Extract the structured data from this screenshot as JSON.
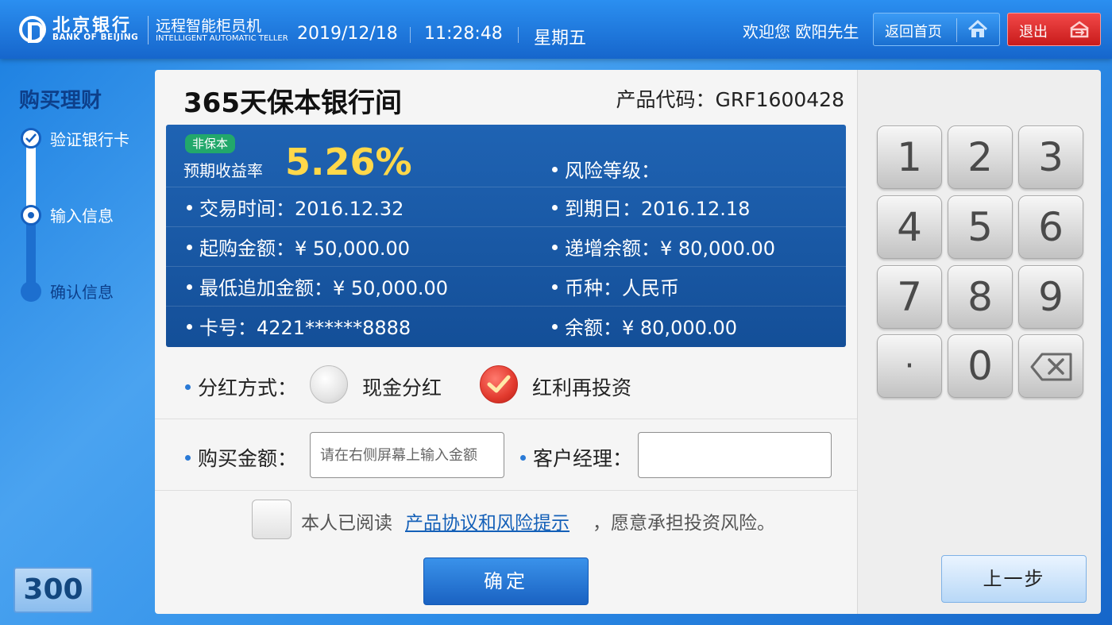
{
  "header": {
    "bank_cn": "北京银行",
    "bank_en": "BANK OF BEIJING",
    "system_cn": "远程智能柜员机",
    "system_en": "INTELLIGENT AUTOMATIC TELLER",
    "date": "2019/12/18",
    "time": "11:28:48",
    "weekday": "星期五",
    "welcome": "欢迎您 欧阳先生",
    "home_label": "返回首页",
    "exit_label": "退出"
  },
  "steps": {
    "title": "购买理财",
    "items": [
      {
        "label": "验证银行卡",
        "state": "done"
      },
      {
        "label": "输入信息",
        "state": "current"
      },
      {
        "label": "确认信息",
        "state": "todo"
      }
    ]
  },
  "countdown": "300",
  "product": {
    "name": "365天保本银行间",
    "code_label": "产品代码：",
    "code": "GRF1600428",
    "tag": "非保本",
    "rate_label": "预期收益率",
    "rate": "5.26%",
    "risk": "风险等级：",
    "trade_time": "交易时间：2016.12.32",
    "maturity": "到期日：2016.12.18",
    "min_amount": "起购金额：¥ 50,000.00",
    "increment": "递增余额：¥ 80,000.00",
    "min_additional": "最低追加金额：¥ 50,000.00",
    "currency": "币种：人民币",
    "card_no": "卡号：4221******8888",
    "balance": "余额：¥ 80,000.00"
  },
  "form": {
    "dividend_label": "分红方式：",
    "dividend_options": [
      {
        "label": "现金分红",
        "selected": false
      },
      {
        "label": "红利再投资",
        "selected": true
      }
    ],
    "amount_label": "购买金额：",
    "amount_placeholder": "请在右侧屏幕上输入金额",
    "amount_value": "",
    "manager_label": "客户经理：",
    "manager_value": "",
    "agree_pre": "本人已阅读",
    "agree_link": "产品协议和风险提示",
    "agree_post": "，愿意承担投资风险。",
    "agree_checked": false,
    "confirm_label": "确定"
  },
  "keypad": {
    "keys": [
      "1",
      "2",
      "3",
      "4",
      "5",
      "6",
      "7",
      "8",
      "9",
      "·",
      "0"
    ],
    "backspace_icon": "backspace-icon",
    "back_label": "上一步"
  },
  "colors": {
    "accent": "#1a6fd0",
    "rate": "#ffd84a",
    "tag": "#22a86b",
    "exit": "#e02a2a"
  }
}
